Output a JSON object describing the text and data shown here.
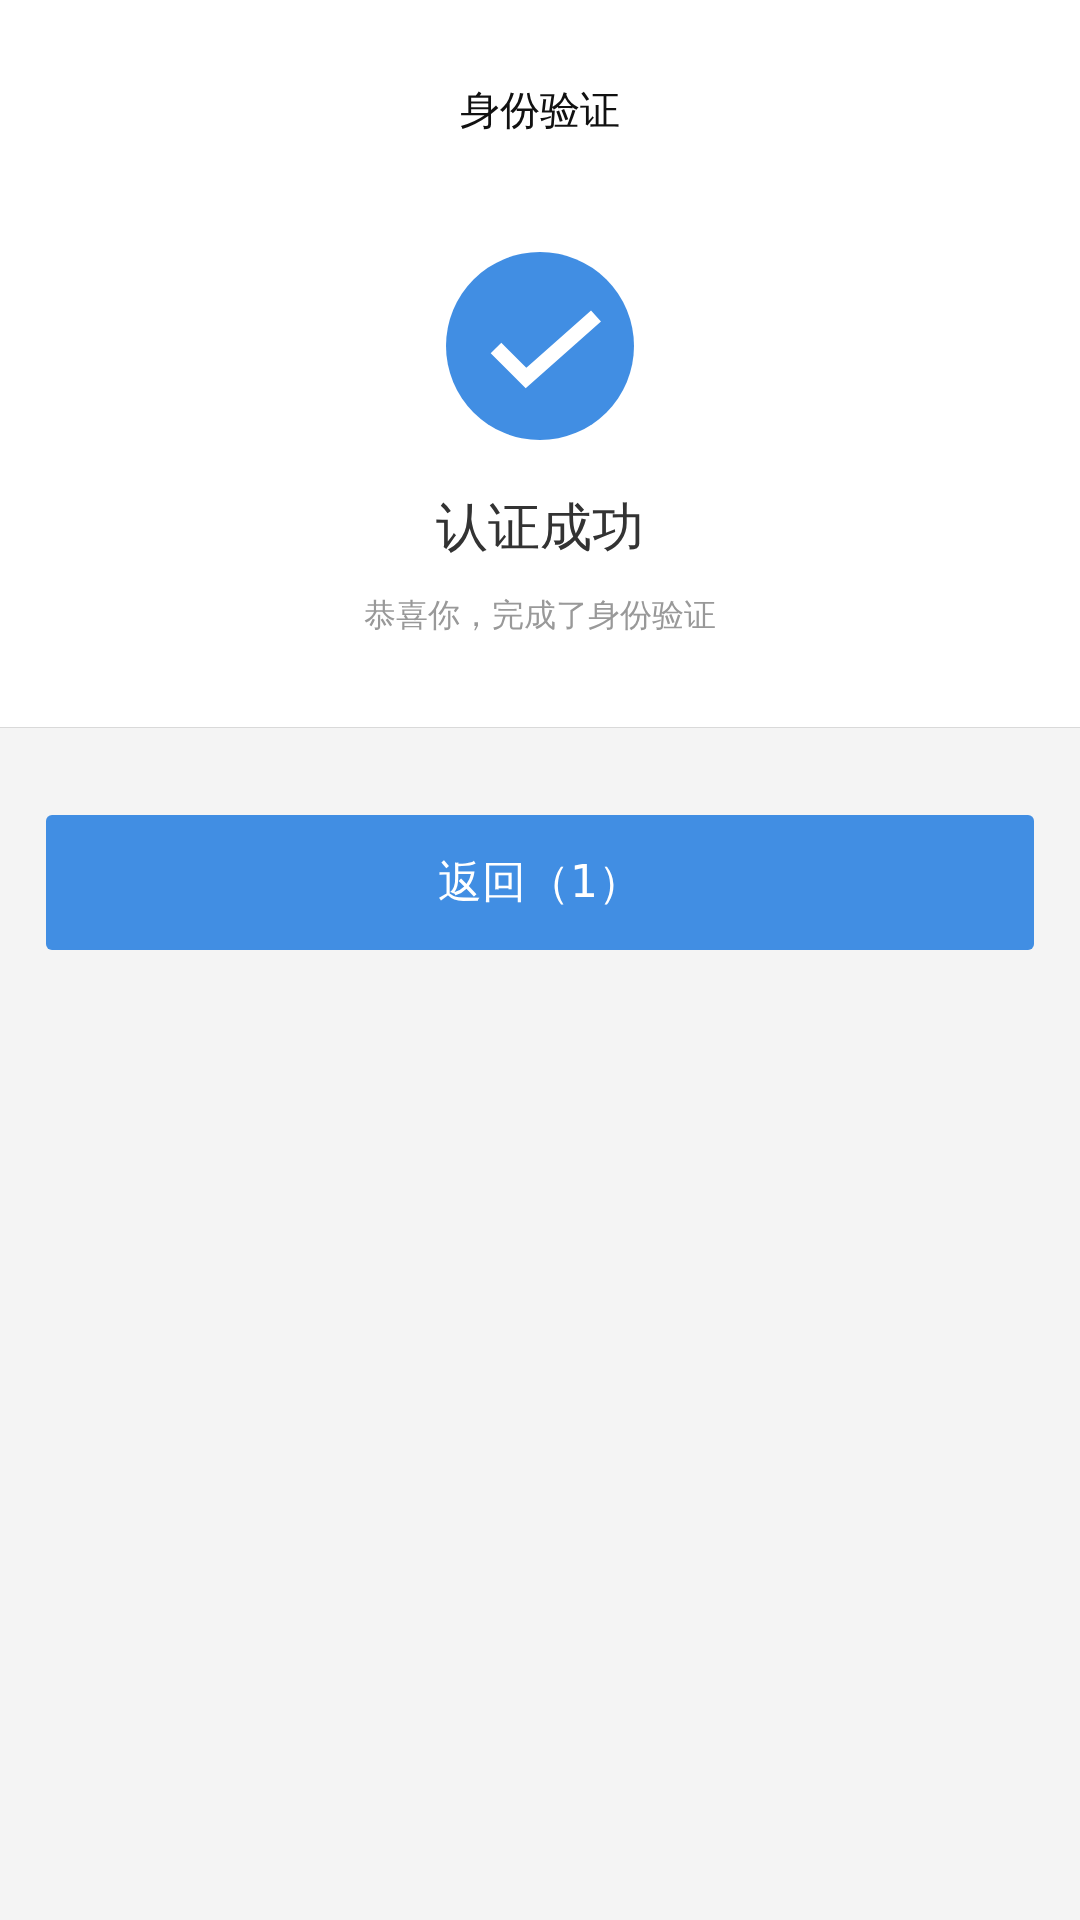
{
  "header": {
    "title": "身份验证"
  },
  "result": {
    "heading": "认证成功",
    "message": "恭喜你，完成了身份验证"
  },
  "button": {
    "label": "返回（1）"
  }
}
